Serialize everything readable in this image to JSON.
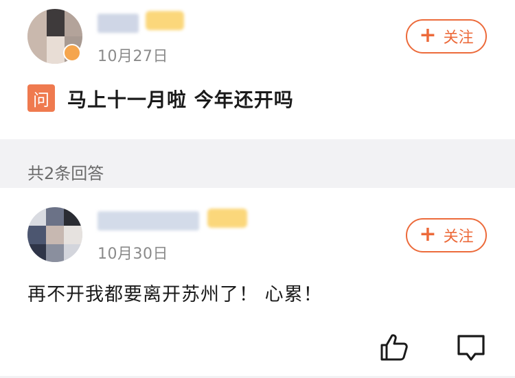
{
  "question": {
    "date": "10月27日",
    "follow_label": "关注",
    "follow_plus": "+",
    "question_mark": "问",
    "text": "马上十一月啦 今年还开吗"
  },
  "answers_header": "共2条回答",
  "answers": [
    {
      "date": "10月30日",
      "follow_label": "关注",
      "follow_plus": "+",
      "text": "再不开我都要离开苏州了！ 心累！"
    }
  ],
  "icons": {
    "like": "thumbs-up-icon",
    "comment": "comment-icon"
  },
  "colors": {
    "accent": "#ec6a3a",
    "question_badge": "#ef7a4f",
    "vip": "#fbd77b",
    "section_bg": "#f2f2f4"
  }
}
